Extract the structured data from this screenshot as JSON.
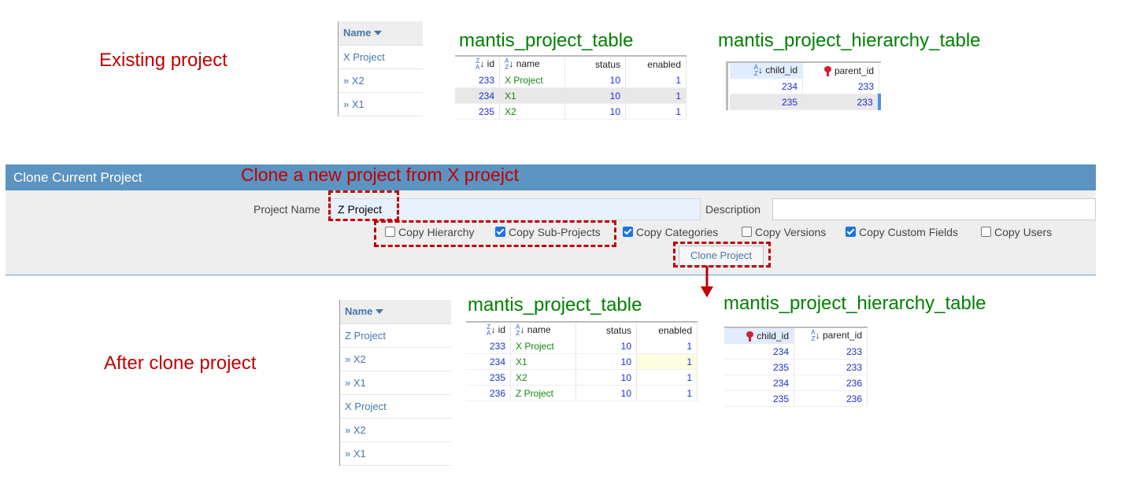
{
  "labels": {
    "existing": "Existing project",
    "after": "After clone project",
    "annotation": "Clone a new project from X proejct"
  },
  "top": {
    "name_list": {
      "header": "Name",
      "rows": [
        "X Project",
        "» X2",
        "» X1"
      ]
    },
    "project_table": {
      "title": "mantis_project_table",
      "columns": [
        "id",
        "name",
        "status",
        "enabled"
      ],
      "rows": [
        [
          "233",
          "X Project",
          "10",
          "1"
        ],
        [
          "234",
          "X1",
          "10",
          "1"
        ],
        [
          "235",
          "X2",
          "10",
          "1"
        ]
      ]
    },
    "hierarchy_table": {
      "title": "mantis_project_hierarchy_table",
      "columns": [
        "child_id",
        "parent_id"
      ],
      "rows": [
        [
          "234",
          "233"
        ],
        [
          "235",
          "233"
        ]
      ]
    }
  },
  "clone_panel": {
    "title": "Clone Current Project",
    "project_name_label": "Project Name",
    "project_name_value": "Z Project",
    "description_label": "Description",
    "checkboxes": [
      {
        "label": "Copy Hierarchy",
        "checked": false
      },
      {
        "label": "Copy Sub-Projects",
        "checked": true
      },
      {
        "label": "Copy Categories",
        "checked": true
      },
      {
        "label": "Copy Versions",
        "checked": false
      },
      {
        "label": "Copy Custom Fields",
        "checked": true
      },
      {
        "label": "Copy Users",
        "checked": false
      }
    ],
    "button_label": "Clone Project"
  },
  "bottom": {
    "name_list": {
      "header": "Name",
      "rows": [
        "Z Project",
        "» X2",
        "» X1",
        "X Project",
        "» X2",
        "» X1"
      ]
    },
    "project_table": {
      "title": "mantis_project_table",
      "columns": [
        "id",
        "name",
        "status",
        "enabled"
      ],
      "rows": [
        [
          "233",
          "X Project",
          "10",
          "1"
        ],
        [
          "234",
          "X1",
          "10",
          "1"
        ],
        [
          "235",
          "X2",
          "10",
          "1"
        ],
        [
          "236",
          "Z Project",
          "10",
          "1"
        ]
      ]
    },
    "hierarchy_table": {
      "title": "mantis_project_hierarchy_table",
      "columns": [
        "child_id",
        "parent_id"
      ],
      "rows": [
        [
          "234",
          "233"
        ],
        [
          "235",
          "233"
        ],
        [
          "234",
          "236"
        ],
        [
          "235",
          "236"
        ]
      ]
    }
  },
  "colors": {
    "accent": "#5b93c1",
    "annotation": "#c00000",
    "table_title": "#008000"
  }
}
